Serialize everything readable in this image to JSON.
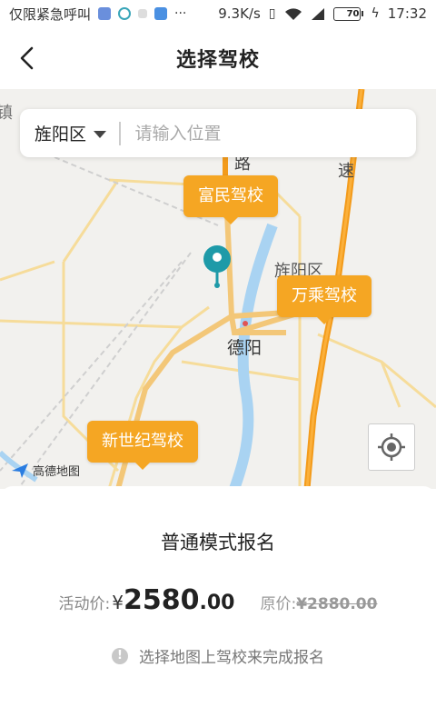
{
  "status_bar": {
    "carrier": "仅限紧急呼叫",
    "speed": "9.3K/s",
    "battery": "70",
    "battery_level": 0.7,
    "time": "17:32"
  },
  "nav": {
    "title": "选择驾校",
    "back_icon": "chevron-left-icon"
  },
  "search": {
    "district": "旌阳区",
    "placeholder": "请输入位置"
  },
  "map": {
    "schools": [
      "富民驾校",
      "万乘驾校",
      "新世纪驾校"
    ],
    "labels": {
      "road": "路",
      "district": "旌阳区",
      "city": "德阳",
      "town_edge": "镇",
      "speed_road": "速"
    },
    "logo_text": "高德地图",
    "pin_color": "#1e9aa8",
    "marker_color": "#f5a623"
  },
  "sheet": {
    "title": "普通模式报名",
    "activity_label": "活动价:",
    "currency": "¥",
    "price_int": "2580",
    "price_dec": ".00",
    "original_label": "原价:",
    "original_price": "¥2880.00",
    "hint": "选择地图上驾校来完成报名"
  }
}
